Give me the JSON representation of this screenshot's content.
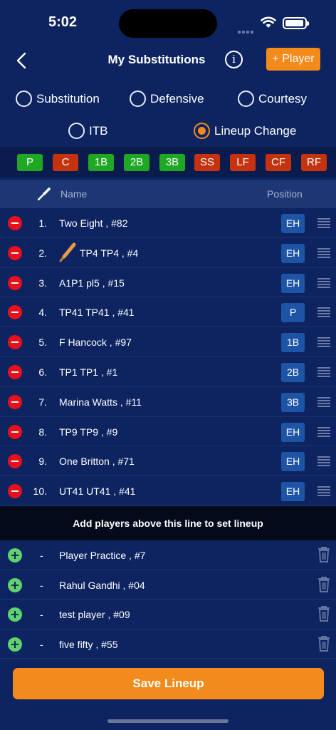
{
  "status": {
    "time": "5:02"
  },
  "header": {
    "title": "My Substitutions",
    "add_player_label": "+ Player"
  },
  "options": {
    "substitution": "Substitution",
    "defensive": "Defensive",
    "courtesy": "Courtesy",
    "itb": "ITB",
    "lineup_change": "Lineup Change",
    "selected": "Lineup Change"
  },
  "chips": [
    {
      "label": "P",
      "state": "filled"
    },
    {
      "label": "C",
      "state": "open"
    },
    {
      "label": "1B",
      "state": "filled"
    },
    {
      "label": "2B",
      "state": "filled"
    },
    {
      "label": "3B",
      "state": "filled"
    },
    {
      "label": "SS",
      "state": "open"
    },
    {
      "label": "LF",
      "state": "open"
    },
    {
      "label": "CF",
      "state": "open"
    },
    {
      "label": "RF",
      "state": "open"
    }
  ],
  "colors": {
    "filled": "#1fa823",
    "open": "#c4330e",
    "accent": "#f28a1c",
    "background": "#0d2461"
  },
  "table": {
    "name_header": "Name",
    "position_header": "Position"
  },
  "lineup": [
    {
      "num": "1.",
      "name": "Two Eight , #82",
      "position": "EH",
      "batting": false
    },
    {
      "num": "2.",
      "name": "TP4 TP4 , #4",
      "position": "EH",
      "batting": true
    },
    {
      "num": "3.",
      "name": "A1P1 pl5 , #15",
      "position": "EH",
      "batting": false
    },
    {
      "num": "4.",
      "name": "TP41 TP41 , #41",
      "position": "P",
      "batting": false
    },
    {
      "num": "5.",
      "name": "F Hancock , #97",
      "position": "1B",
      "batting": false
    },
    {
      "num": "6.",
      "name": "TP1 TP1 , #1",
      "position": "2B",
      "batting": false
    },
    {
      "num": "7.",
      "name": "Marina Watts , #11",
      "position": "3B",
      "batting": false
    },
    {
      "num": "8.",
      "name": "TP9 TP9 , #9",
      "position": "EH",
      "batting": false
    },
    {
      "num": "9.",
      "name": "One Britton , #71",
      "position": "EH",
      "batting": false
    },
    {
      "num": "10.",
      "name": "UT41 UT41 , #41",
      "position": "EH",
      "batting": false
    }
  ],
  "divider_text": "Add players above this line to set lineup",
  "bench": [
    {
      "dash": "-",
      "name": "Player Practice , #7"
    },
    {
      "dash": "-",
      "name": "Rahul Gandhi , #04"
    },
    {
      "dash": "-",
      "name": "test player , #09"
    },
    {
      "dash": "-",
      "name": "five fifty , #55"
    }
  ],
  "save_label": "Save Lineup"
}
